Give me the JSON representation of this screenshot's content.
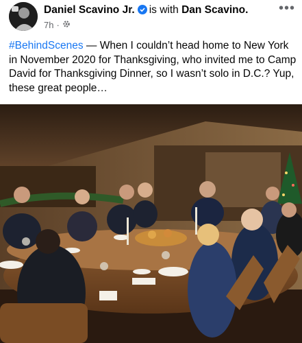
{
  "post": {
    "author": "Daniel Scavino Jr.",
    "with_text": "is with",
    "tagged": "Dan Scavino.",
    "time": "7h",
    "separator": "·",
    "more_label": "•••",
    "hashtag": "#BehindScenes",
    "body": " — When I couldn’t head home to New York in November 2020 for Thanksgiving, who invited me to Camp David for Thanksgiving Dinner, so I wasn’t solo in D.C.? Yup, these great people…"
  },
  "icons": {
    "verified": "verified-badge-icon",
    "audience": "gear-icon",
    "more": "more-options-icon"
  },
  "colors": {
    "link": "#1877f2",
    "text": "#050505",
    "meta": "#65676b"
  }
}
